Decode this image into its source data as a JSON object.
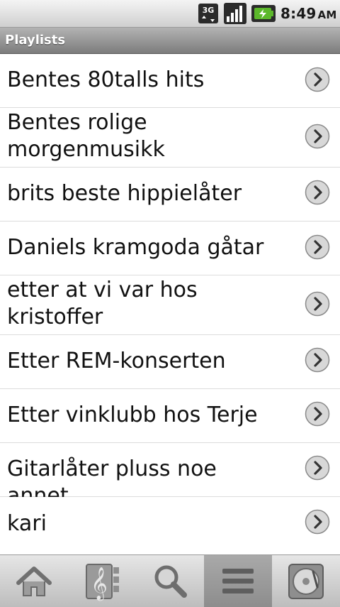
{
  "status_bar": {
    "network": "3G",
    "time": "8:49",
    "ampm": "AM",
    "icons": [
      "3g-data-icon",
      "signal-strength-icon",
      "battery-charging-icon"
    ]
  },
  "header": {
    "title": "Playlists"
  },
  "playlists": [
    {
      "label": "Bentes 80talls hits"
    },
    {
      "label": "Bentes rolige morgenmusikk"
    },
    {
      "label": "brits beste hippielåter"
    },
    {
      "label": "Daniels kramgoda gåtar"
    },
    {
      "label": "etter at vi var hos kristoffer"
    },
    {
      "label": "Etter REM-konserten"
    },
    {
      "label": "Etter vinklubb hos Terje"
    },
    {
      "label": "Gitarlåter pluss noe annet"
    },
    {
      "label": "kari"
    }
  ],
  "toolbar": {
    "items": [
      {
        "icon": "home-icon"
      },
      {
        "icon": "music-library-icon"
      },
      {
        "icon": "search-icon"
      },
      {
        "icon": "playlists-icon",
        "active": true
      },
      {
        "icon": "now-playing-icon"
      }
    ]
  },
  "colors": {
    "title_bar": "#8c8c8c",
    "active_tab": "#9a9a9a",
    "battery_accent": "#5cb82b"
  }
}
